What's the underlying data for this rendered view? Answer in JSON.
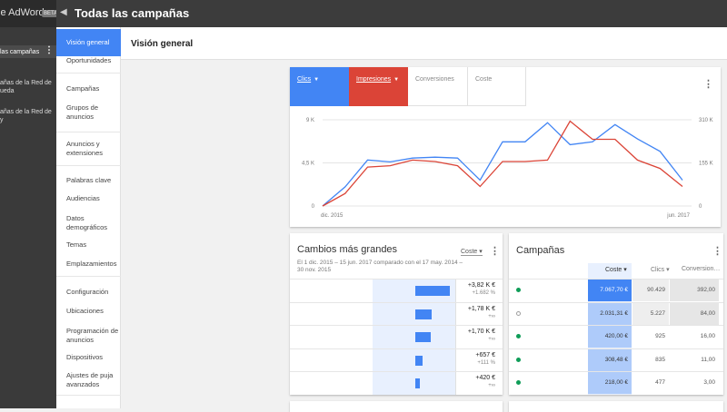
{
  "app": {
    "brand": "gle AdWords",
    "badge": "BETA",
    "title": "Todas las campañas"
  },
  "campaign_list": {
    "items": [
      {
        "label": "las campañas"
      },
      {
        "label": "añas de la Red de\nueda"
      },
      {
        "label": "añas de la Red de\ny"
      }
    ],
    "menu_glyph": "⋮"
  },
  "nav": {
    "items": [
      {
        "label": "Visión general"
      },
      {
        "label": "Oportunidades"
      },
      {
        "label": "Campañas"
      },
      {
        "label": "Grupos de\nanuncios"
      },
      {
        "label": "Anuncios y\nextensiones"
      },
      {
        "label": "Palabras clave"
      },
      {
        "label": "Audiencias"
      },
      {
        "label": "Datos\ndemográficos"
      },
      {
        "label": "Temas"
      },
      {
        "label": "Emplazamientos"
      },
      {
        "label": "Configuración"
      },
      {
        "label": "Ubicaciones"
      },
      {
        "label": "Programación de\nanuncios"
      },
      {
        "label": "Dispositivos"
      },
      {
        "label": "Ajustes de puja\navanzados"
      }
    ]
  },
  "header": {
    "title": "Visión general"
  },
  "chart_card": {
    "tabs": [
      {
        "label": "Clics",
        "color": "#4285f4",
        "dropdown": true
      },
      {
        "label": "Impresiones",
        "color": "#db4437",
        "dropdown": true
      },
      {
        "label": "Conversiones"
      },
      {
        "label": "Coste"
      }
    ],
    "menu_glyph": "⋮"
  },
  "chart_data": {
    "type": "line",
    "x": [
      "dic. 2015",
      "",
      "",
      "",
      "",
      "",
      "",
      "",
      "",
      "",
      "",
      "",
      "",
      "",
      "",
      "",
      "",
      "",
      "",
      "jun. 2017"
    ],
    "x_labels": {
      "start": "dic. 2015",
      "end": "jun. 2017"
    },
    "y_left_ticks": [
      "9 K",
      "4,5 K",
      "0"
    ],
    "y_right_ticks": [
      "310 K",
      "155 K",
      "0"
    ],
    "ylim_left": [
      0,
      9000
    ],
    "ylim_right": [
      0,
      310000
    ],
    "series": [
      {
        "name": "Clics",
        "color": "#4285f4",
        "axis": "left",
        "values": [
          0,
          2000,
          4800,
          4600,
          5000,
          5100,
          5000,
          2700,
          6700,
          6700,
          8700,
          6400,
          6700,
          8500,
          7000,
          5700,
          2700
        ]
      },
      {
        "name": "Impresiones",
        "color": "#db4437",
        "axis": "right",
        "values": [
          0,
          45000,
          140000,
          145000,
          165000,
          160000,
          145000,
          70000,
          160000,
          160000,
          165000,
          305000,
          240000,
          240000,
          165000,
          135000,
          70000
        ]
      }
    ],
    "grid": true
  },
  "changes_card": {
    "title": "Cambios más grandes",
    "subtitle": "El 1 dic. 2015 – 15 jun. 2017 comparado con el 17 may. 2014 –\n30 nov. 2015",
    "sort_label": "Coste",
    "menu_glyph": "⋮",
    "rows": [
      {
        "value": "+3,82 K €",
        "pct": "+1.682 %",
        "bar": 1.0
      },
      {
        "value": "+1,78 K €",
        "pct": "+∞",
        "bar": 0.47
      },
      {
        "value": "+1,70 K €",
        "pct": "+∞",
        "bar": 0.45
      },
      {
        "value": "+657 €",
        "pct": "+111 %",
        "bar": 0.2
      },
      {
        "value": "+420 €",
        "pct": "+∞",
        "bar": 0.12
      }
    ]
  },
  "campaigns_card": {
    "title": "Campañas",
    "menu_glyph": "⋮",
    "columns": [
      "Coste",
      "Clics",
      "Conversion…"
    ],
    "rows": [
      {
        "status": "green",
        "coste": "7.067,70 €",
        "clics": "90.429",
        "conv": "392,00"
      },
      {
        "status": "gray",
        "coste": "2.031,31 €",
        "clics": "5.227",
        "conv": "84,00"
      },
      {
        "status": "green",
        "coste": "420,00 €",
        "clics": "925",
        "conv": "16,00"
      },
      {
        "status": "green",
        "coste": "308,48 €",
        "clics": "835",
        "conv": "11,00"
      },
      {
        "status": "green",
        "coste": "218,00 €",
        "clics": "477",
        "conv": "3,00"
      }
    ],
    "colors": {
      "green": "#0f9d58",
      "gray": "#9e9e9e",
      "header_blue": "#4285f4",
      "cell_blue": "#aecbfa"
    }
  }
}
